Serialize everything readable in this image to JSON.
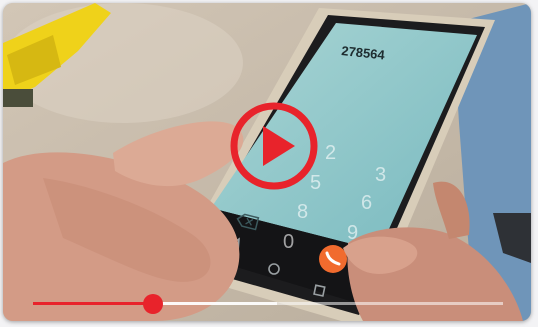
{
  "video": {
    "accent_color": "#e8232b",
    "played_fraction": 0.255,
    "buffered_fraction": 0.52
  },
  "phone": {
    "display_number": "278564",
    "keypad": [
      "2",
      "5",
      "8",
      "0",
      "3",
      "6",
      "9"
    ]
  },
  "icons": {
    "play": "play-icon",
    "backspace": "backspace-icon",
    "nav_back": "back-triangle-icon",
    "nav_home": "home-circle-icon",
    "nav_recents": "recents-square-icon",
    "call": "phone-call-icon"
  }
}
